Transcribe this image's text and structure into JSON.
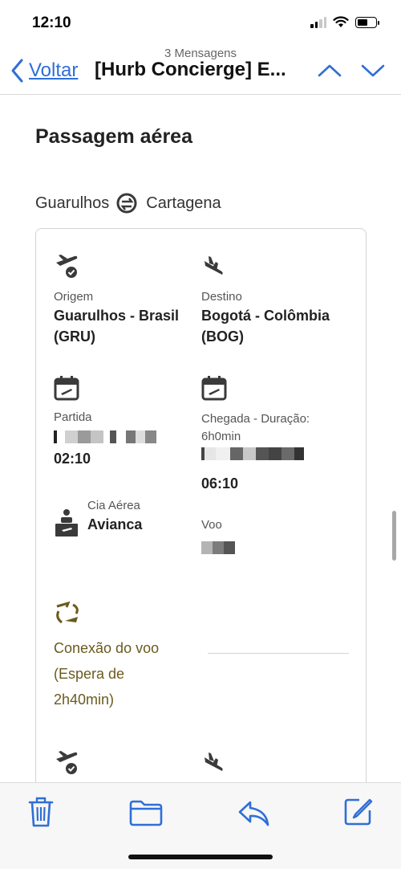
{
  "status": {
    "time": "12:10"
  },
  "nav": {
    "message_count": "3 Mensagens",
    "back_label": "Voltar",
    "subject": "[Hurb Concierge] E..."
  },
  "flight": {
    "section_title": "Passagem aérea",
    "route_from": "Guarulhos",
    "route_to": "Cartagena",
    "origin_label": "Origem",
    "origin_value": "Guarulhos - Brasil (GRU)",
    "destination_label": "Destino",
    "destination_value": "Bogotá - Colômbia (BOG)",
    "departure_label": "Partida",
    "departure_time": "02:10",
    "arrival_label": "Chegada - Duração: 6h0min",
    "arrival_time": "06:10",
    "airline_label": "Cia Aérea",
    "airline_value": "Avianca",
    "flight_label": "Voo",
    "connection_text": "Conexão do voo (Espera de 2h40min)"
  },
  "colors": {
    "accent_blue": "#2f6fd6",
    "connection_gold": "#6b5a1e",
    "icon_dark": "#3a3a3a"
  },
  "icons": [
    "chevron-left-icon",
    "chevron-up-icon",
    "chevron-down-icon",
    "plane-takeoff-icon",
    "plane-landing-icon",
    "calendar-icon",
    "airline-counter-icon",
    "connection-icon",
    "trash-icon",
    "folder-icon",
    "reply-icon",
    "compose-icon"
  ]
}
